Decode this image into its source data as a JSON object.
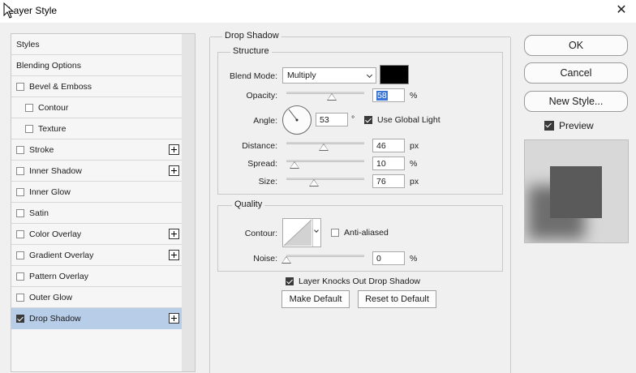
{
  "window": {
    "title": "Layer Style",
    "close_symbol": "✕"
  },
  "styles_list": {
    "items": [
      {
        "label": "Styles",
        "checkbox": false,
        "checked": false,
        "indent": false,
        "plus": false,
        "selected": false
      },
      {
        "label": "Blending Options",
        "checkbox": false,
        "checked": false,
        "indent": false,
        "plus": false,
        "selected": false
      },
      {
        "label": "Bevel & Emboss",
        "checkbox": true,
        "checked": false,
        "indent": false,
        "plus": false,
        "selected": false
      },
      {
        "label": "Contour",
        "checkbox": true,
        "checked": false,
        "indent": true,
        "plus": false,
        "selected": false
      },
      {
        "label": "Texture",
        "checkbox": true,
        "checked": false,
        "indent": true,
        "plus": false,
        "selected": false
      },
      {
        "label": "Stroke",
        "checkbox": true,
        "checked": false,
        "indent": false,
        "plus": true,
        "selected": false
      },
      {
        "label": "Inner Shadow",
        "checkbox": true,
        "checked": false,
        "indent": false,
        "plus": true,
        "selected": false
      },
      {
        "label": "Inner Glow",
        "checkbox": true,
        "checked": false,
        "indent": false,
        "plus": false,
        "selected": false
      },
      {
        "label": "Satin",
        "checkbox": true,
        "checked": false,
        "indent": false,
        "plus": false,
        "selected": false
      },
      {
        "label": "Color Overlay",
        "checkbox": true,
        "checked": false,
        "indent": false,
        "plus": true,
        "selected": false
      },
      {
        "label": "Gradient Overlay",
        "checkbox": true,
        "checked": false,
        "indent": false,
        "plus": true,
        "selected": false
      },
      {
        "label": "Pattern Overlay",
        "checkbox": true,
        "checked": false,
        "indent": false,
        "plus": false,
        "selected": false
      },
      {
        "label": "Outer Glow",
        "checkbox": true,
        "checked": false,
        "indent": false,
        "plus": false,
        "selected": false
      },
      {
        "label": "Drop Shadow",
        "checkbox": true,
        "checked": true,
        "indent": false,
        "plus": true,
        "selected": true
      }
    ]
  },
  "drop_shadow": {
    "section_title": "Drop Shadow",
    "structure": {
      "title": "Structure",
      "blend_mode_label": "Blend Mode:",
      "blend_mode_value": "Multiply",
      "shadow_color": "#000000",
      "opacity_label": "Opacity:",
      "opacity_value": "58",
      "opacity_unit": "%",
      "angle_label": "Angle:",
      "angle_value": "53",
      "angle_unit": "°",
      "use_global_light_label": "Use Global Light",
      "use_global_light_checked": true,
      "distance_label": "Distance:",
      "distance_value": "46",
      "distance_unit": "px",
      "spread_label": "Spread:",
      "spread_value": "10",
      "spread_unit": "%",
      "size_label": "Size:",
      "size_value": "76",
      "size_unit": "px"
    },
    "quality": {
      "title": "Quality",
      "contour_label": "Contour:",
      "anti_aliased_label": "Anti-aliased",
      "anti_aliased_checked": false,
      "noise_label": "Noise:",
      "noise_value": "0",
      "noise_unit": "%"
    },
    "layer_knocks_out_label": "Layer Knocks Out Drop Shadow",
    "layer_knocks_out_checked": true,
    "make_default_label": "Make Default",
    "reset_to_default_label": "Reset to Default"
  },
  "actions": {
    "ok_label": "OK",
    "cancel_label": "Cancel",
    "new_style_label": "New Style...",
    "preview_label": "Preview",
    "preview_checked": true
  },
  "colors": {
    "selected_row": "#b7cde8",
    "preview_square": "#5a5a5a",
    "preview_background": "#d8d8d8"
  }
}
